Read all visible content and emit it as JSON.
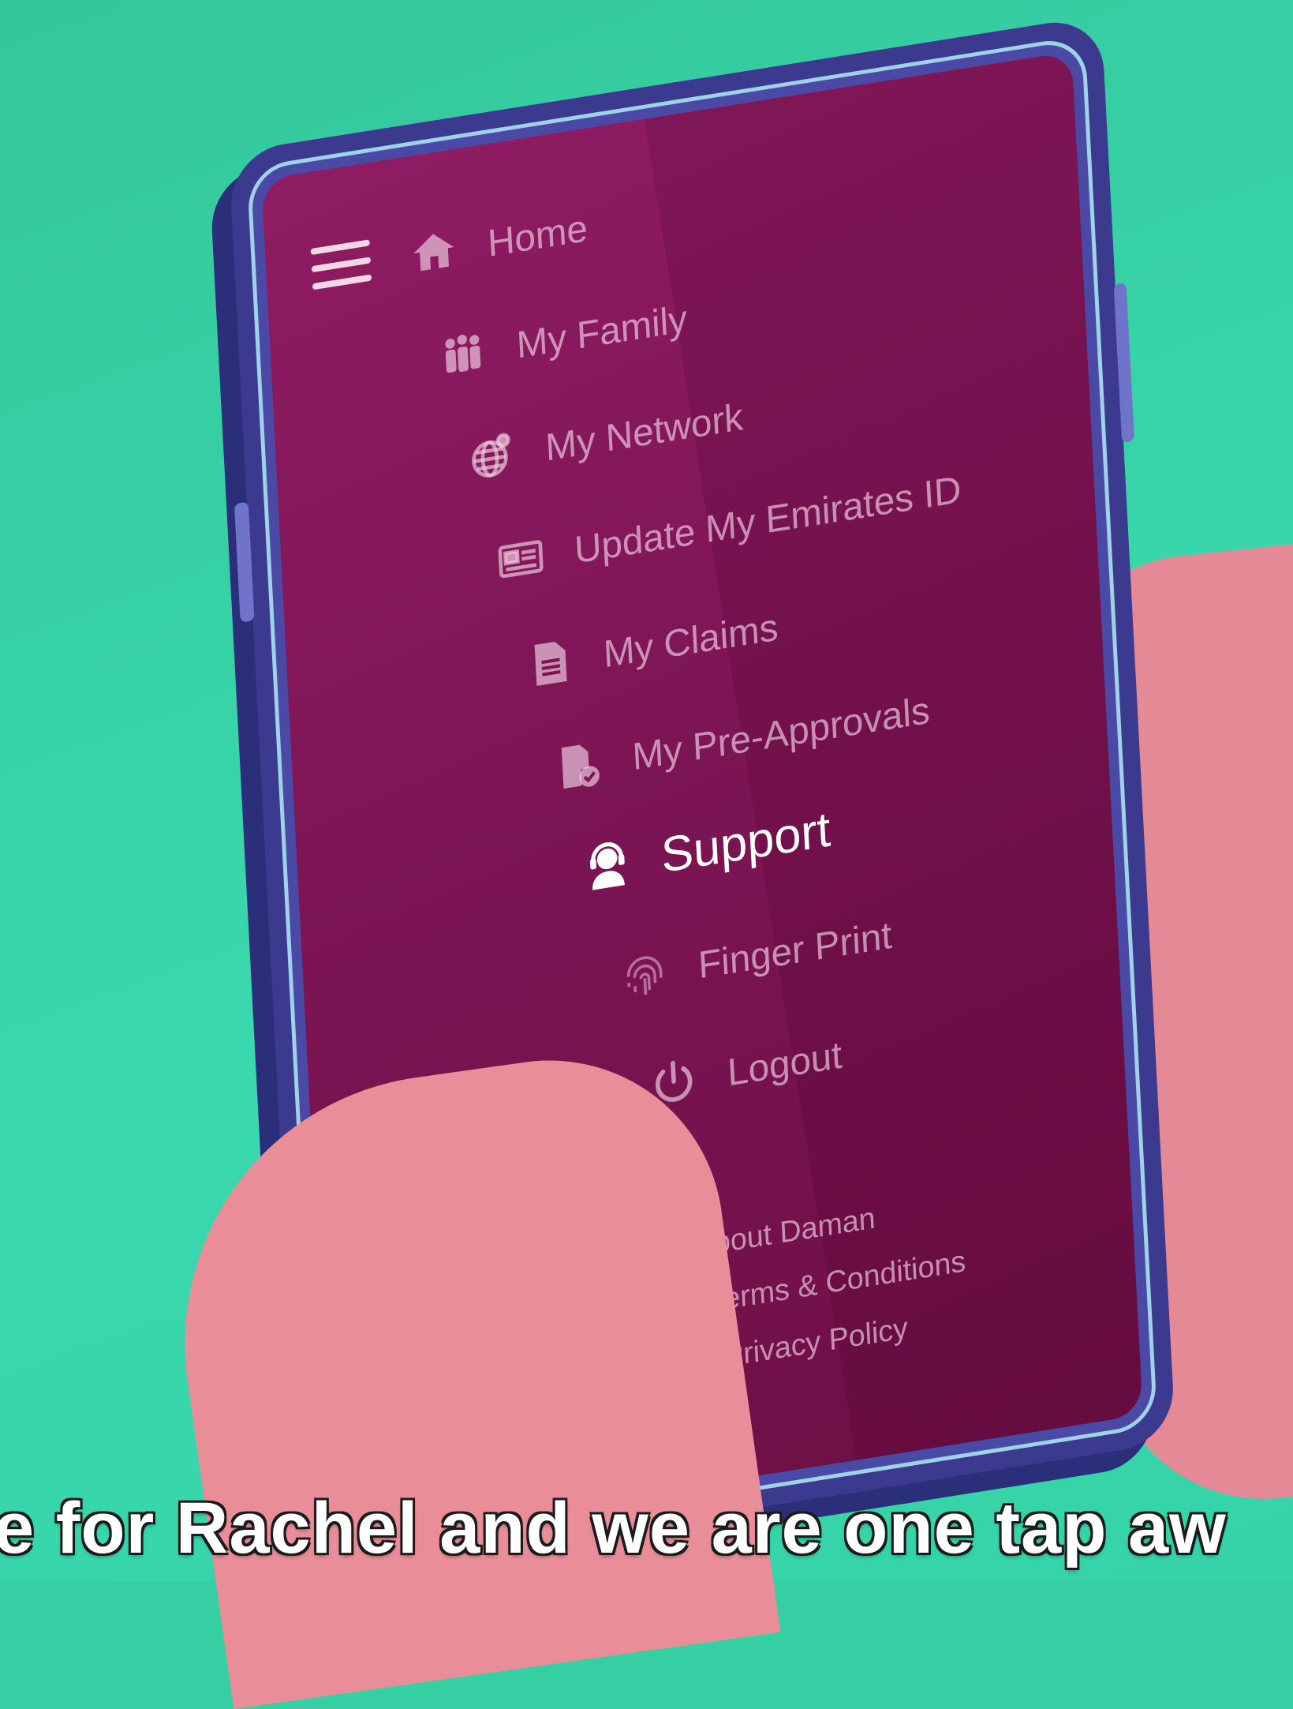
{
  "menu": {
    "items": [
      {
        "label": "Home",
        "icon": "home-icon"
      },
      {
        "label": "My Family",
        "icon": "family-icon"
      },
      {
        "label": "My Network",
        "icon": "globe-icon"
      },
      {
        "label": "Update My Emirates ID",
        "icon": "id-card-icon"
      },
      {
        "label": "My Claims",
        "icon": "document-icon"
      },
      {
        "label": "My Pre-Approvals",
        "icon": "approved-document-icon"
      },
      {
        "label": "Support",
        "icon": "support-agent-icon",
        "active": true
      },
      {
        "label": "Finger Print",
        "icon": "fingerprint-icon"
      },
      {
        "label": "Logout",
        "icon": "power-icon"
      }
    ],
    "footer": [
      "About Daman",
      "Terms & Conditions",
      "Privacy Policy"
    ]
  },
  "caption": "e for Rachel and we are one tap aw",
  "colors": {
    "background": "#35cfa3",
    "screen": "#7d1555",
    "phone_body": "#3b3a8f",
    "hand": "#e98e98",
    "active_text": "#ffffff"
  }
}
